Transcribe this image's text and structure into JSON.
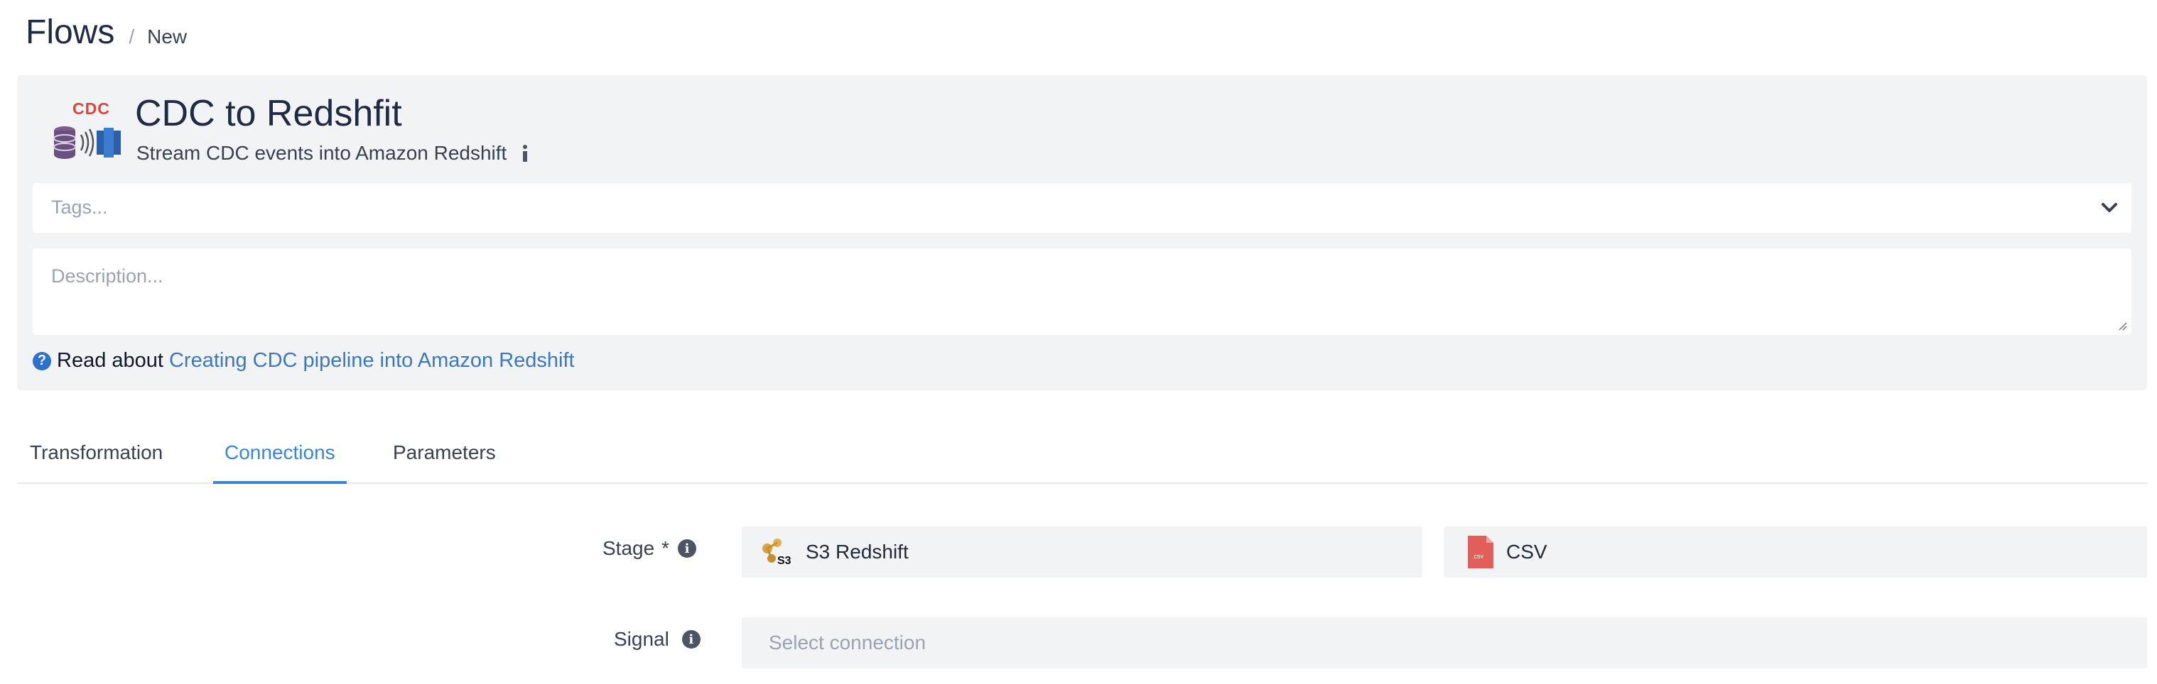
{
  "breadcrumb": {
    "title": "Flows",
    "separator": "/",
    "current": "New"
  },
  "flow": {
    "logo_text": "CDC",
    "name": "CDC to Redshfit",
    "subtitle": "Stream CDC events into Amazon Redshift"
  },
  "tags": {
    "placeholder": "Tags..."
  },
  "description": {
    "placeholder": "Description..."
  },
  "read_about": {
    "prefix": "Read about",
    "link_text": "Creating CDC pipeline into Amazon Redshift"
  },
  "tabs": [
    {
      "label": "Transformation"
    },
    {
      "label": "Connections",
      "active": true
    },
    {
      "label": "Parameters"
    }
  ],
  "connections": {
    "stage": {
      "label": "Stage",
      "required_mark": "*",
      "primary_value": "S3 Redshift",
      "primary_icon": "s3-redshift-icon",
      "format_value": "CSV",
      "format_icon": "csv-file-icon",
      "format_icon_text": ".csv"
    },
    "signal": {
      "label": "Signal",
      "placeholder": "Select connection"
    }
  },
  "colors": {
    "accent": "#3a86d6",
    "link": "#3a78c2",
    "panel_bg": "#f2f3f5",
    "logo_red": "#d9473b"
  }
}
